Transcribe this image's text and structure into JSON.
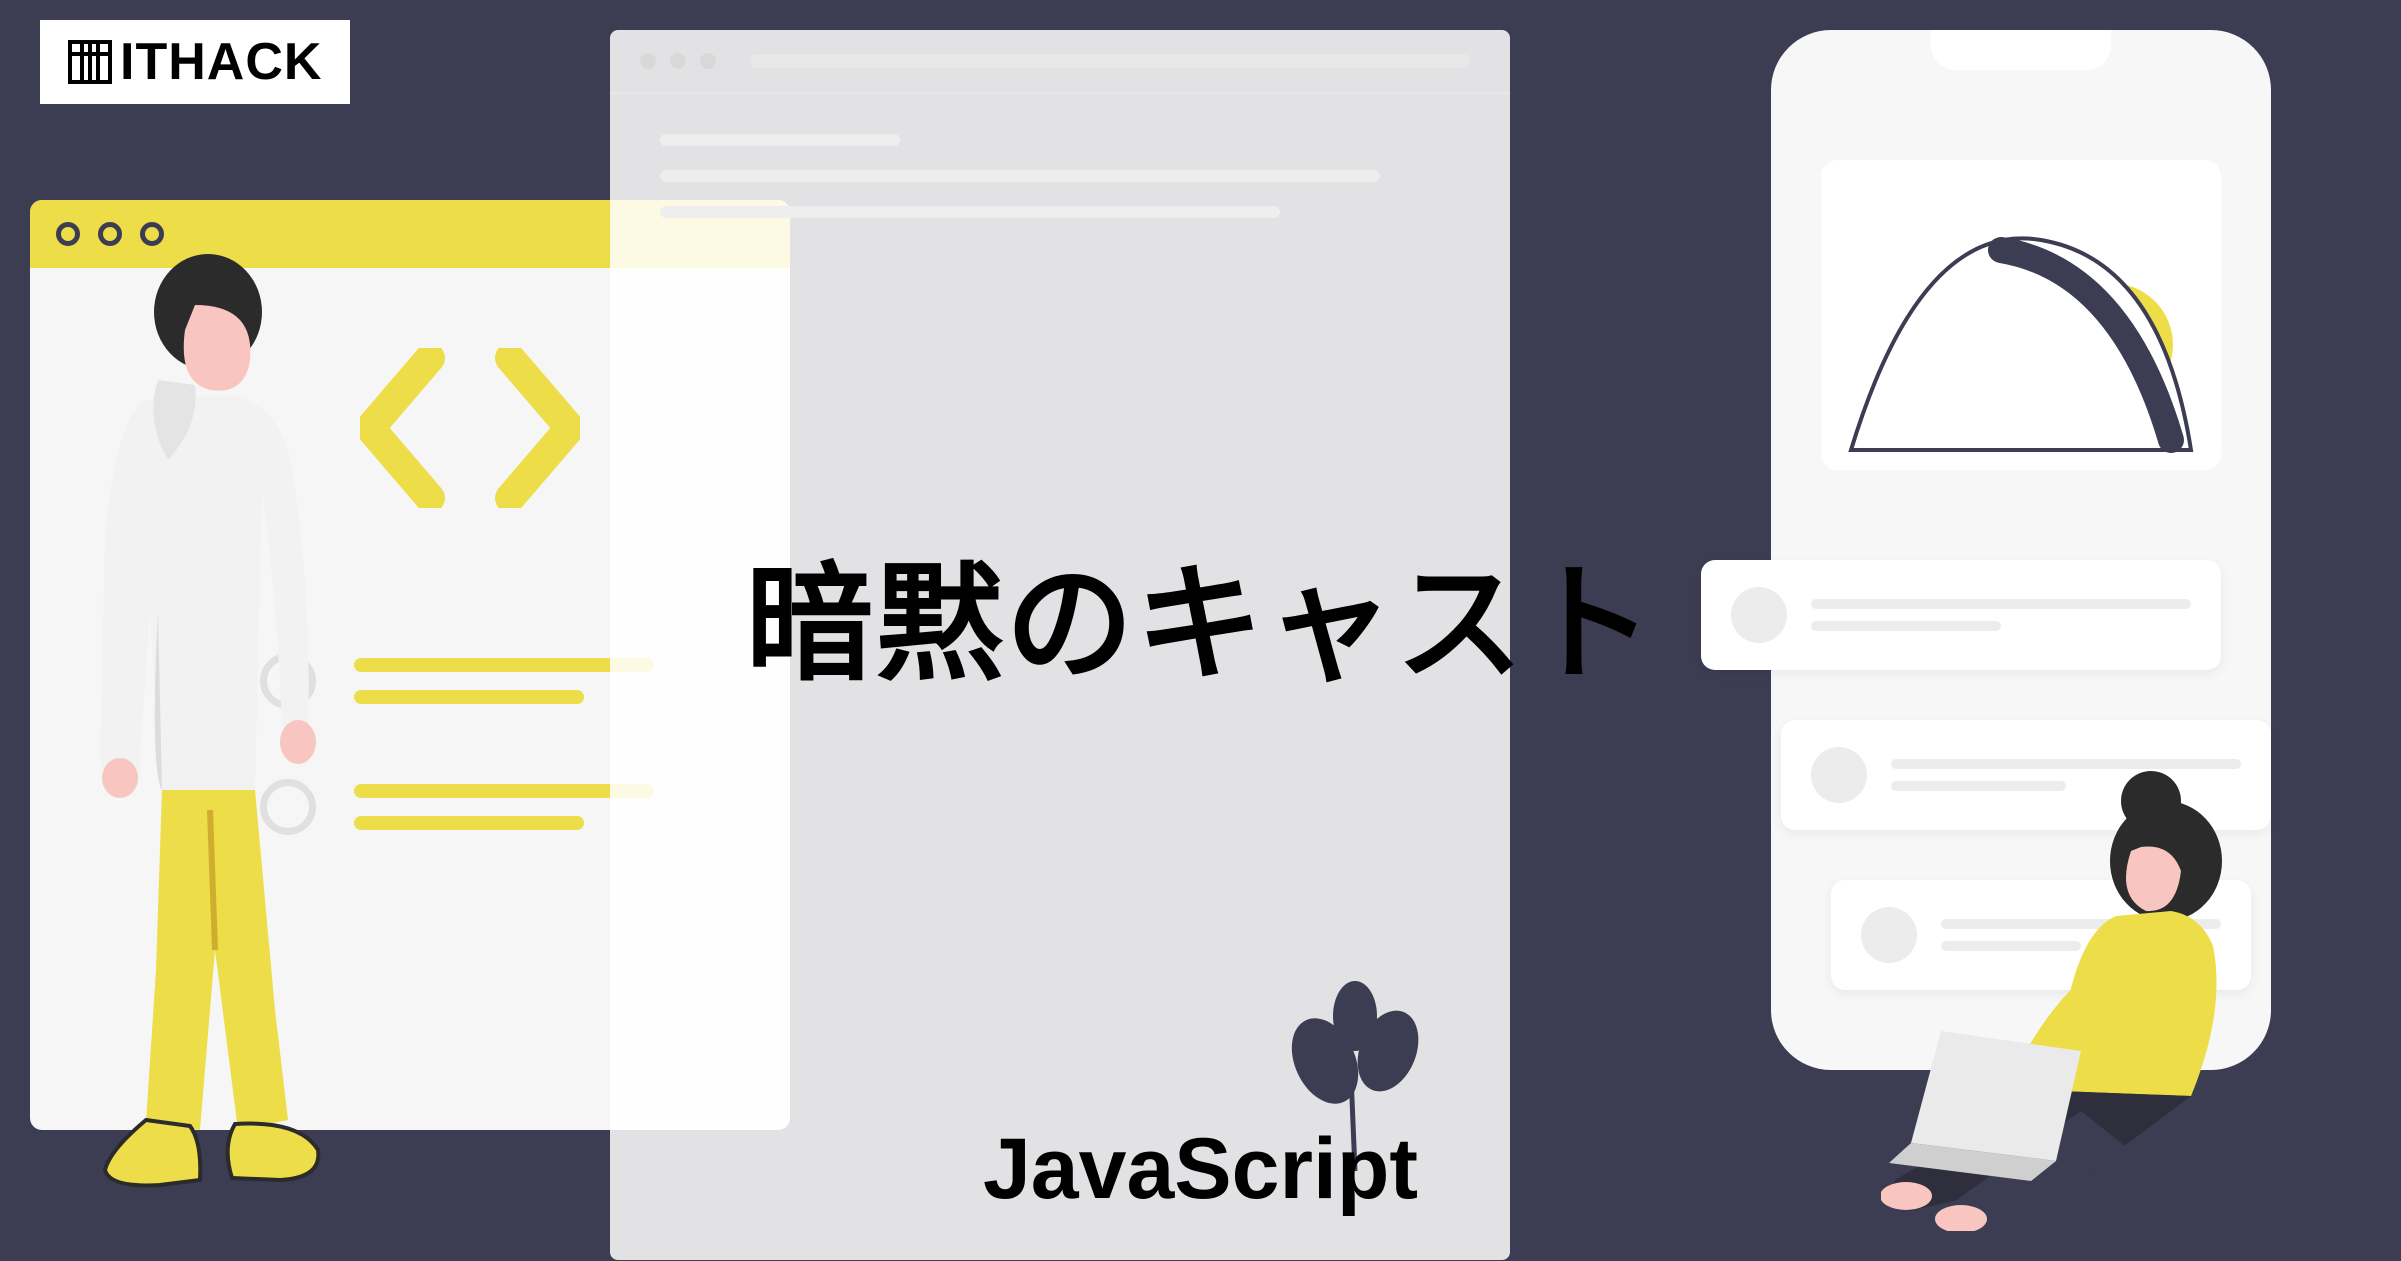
{
  "logo": {
    "text": "ITHACK"
  },
  "main": {
    "title": "暗黙のキャスト",
    "subtitle": "JavaScript"
  },
  "colors": {
    "background": "#3c3d52",
    "accent": "#eddd49",
    "skin": "#f8c5c0"
  }
}
